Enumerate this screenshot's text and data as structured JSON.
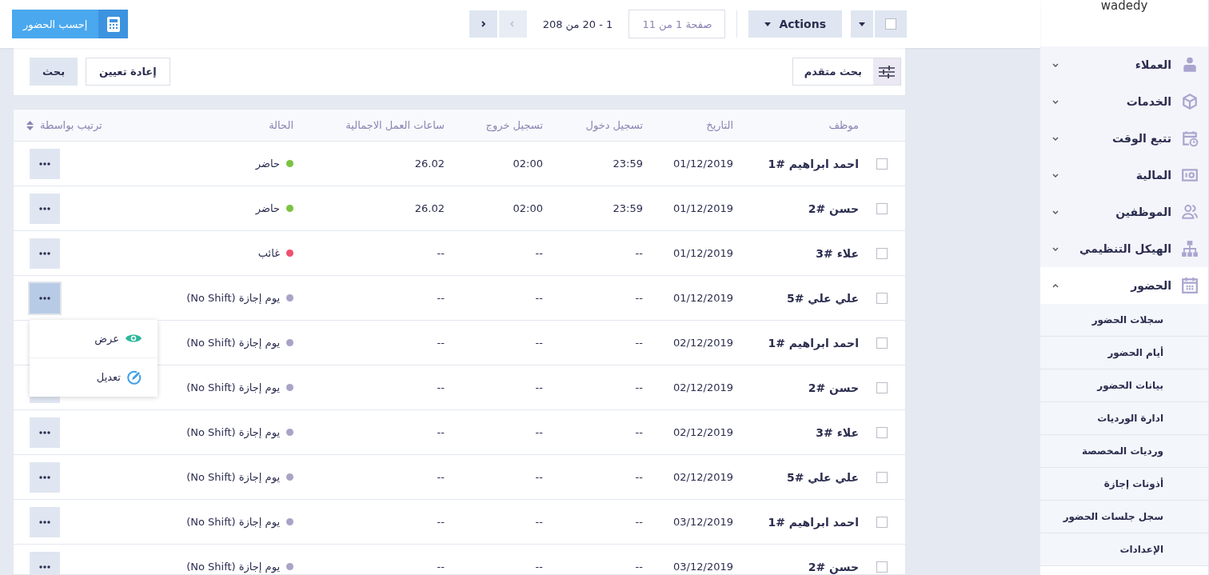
{
  "top_bar": {
    "select_all": {
      "checked": false
    },
    "actions_button": "Actions",
    "page_field": "صفحة 1 من 11",
    "range": "1 - 20 من 208",
    "pager": [
      {
        "kind": "prev",
        "disabled": true
      },
      {
        "kind": "next",
        "disabled": false
      }
    ],
    "calculate_button": "إحسب الحضور"
  },
  "filters": {
    "advanced_search": "بحث متقدم",
    "reset_button": "إعادة تعيين",
    "search_button": "بحث"
  },
  "table": {
    "columns": [
      "موظف",
      "التاريخ",
      "تسجيل دخول",
      "تسجيل خروج",
      "ساعات العمل الاجمالية",
      "الحالة",
      "ترتيب بواسطة"
    ],
    "rows": [
      {
        "checked": false,
        "employee": "احمد ابراهيم #1",
        "date": "01/12/2019",
        "check_in": "23:59",
        "check_out": "02:00",
        "total_hours": "26.02",
        "status": "حاضر",
        "color": "#7cc242",
        "menu_open": false
      },
      {
        "checked": false,
        "employee": "حسن #2",
        "date": "01/12/2019",
        "check_in": "23:59",
        "check_out": "02:00",
        "total_hours": "26.02",
        "status": "حاضر",
        "color": "#7cc242",
        "menu_open": false
      },
      {
        "checked": false,
        "employee": "علاء #3",
        "date": "01/12/2019",
        "check_in": "--",
        "check_out": "--",
        "total_hours": "--",
        "status": "غائب",
        "color": "#f0506e",
        "menu_open": false
      },
      {
        "checked": false,
        "employee": "علي علي #5",
        "date": "01/12/2019",
        "check_in": "--",
        "check_out": "--",
        "total_hours": "--",
        "status": "يوم إجازة (No Shift)",
        "color": "#a8a4c6",
        "menu_open": true
      },
      {
        "checked": false,
        "employee": "احمد ابراهيم #1",
        "date": "02/12/2019",
        "check_in": "--",
        "check_out": "--",
        "total_hours": "--",
        "status": "يوم إجازة (No Shift)",
        "color": "#a8a4c6",
        "menu_open": false
      },
      {
        "checked": false,
        "employee": "حسن #2",
        "date": "02/12/2019",
        "check_in": "--",
        "check_out": "--",
        "total_hours": "--",
        "status": "يوم إجازة (No Shift)",
        "color": "#a8a4c6",
        "menu_open": false
      },
      {
        "checked": false,
        "employee": "علاء #3",
        "date": "02/12/2019",
        "check_in": "--",
        "check_out": "--",
        "total_hours": "--",
        "status": "يوم إجازة (No Shift)",
        "color": "#a8a4c6",
        "menu_open": false
      },
      {
        "checked": false,
        "employee": "علي علي #5",
        "date": "02/12/2019",
        "check_in": "--",
        "check_out": "--",
        "total_hours": "--",
        "status": "يوم إجازة (No Shift)",
        "color": "#a8a4c6",
        "menu_open": false
      },
      {
        "checked": false,
        "employee": "احمد ابراهيم #1",
        "date": "03/12/2019",
        "check_in": "--",
        "check_out": "--",
        "total_hours": "--",
        "status": "يوم إجازة (No Shift)",
        "color": "#a8a4c6",
        "menu_open": false
      },
      {
        "checked": false,
        "employee": "حسن #2",
        "date": "03/12/2019",
        "check_in": "--",
        "check_out": "--",
        "total_hours": "--",
        "status": "يوم إجازة (No Shift)",
        "color": "#a8a4c6",
        "menu_open": false
      }
    ],
    "row_menu": [
      {
        "kind": "view",
        "label": "عرض"
      },
      {
        "kind": "edit",
        "label": "تعديل"
      }
    ]
  },
  "sidebar": {
    "account": "wadedy",
    "items": [
      {
        "kind": "person",
        "label": "العملاء",
        "expanded": false
      },
      {
        "kind": "box",
        "label": "الخدمات",
        "expanded": false
      },
      {
        "kind": "calendar-clock",
        "label": "تتبع الوقت",
        "expanded": false
      },
      {
        "kind": "safe",
        "label": "المالية",
        "expanded": false
      },
      {
        "kind": "users",
        "label": "الموظفين",
        "expanded": false
      },
      {
        "kind": "hierarchy",
        "label": "الهيكل التنظيمي",
        "expanded": false
      },
      {
        "kind": "calendar",
        "label": "الحضور",
        "expanded": true,
        "children": [
          {
            "label": "سجلات الحضور"
          },
          {
            "label": "أيام الحضور"
          },
          {
            "label": "بيانات الحضور"
          },
          {
            "label": "ادارة الورديات"
          },
          {
            "label": "ورديات المخصصة"
          },
          {
            "label": "أذونات إجازة"
          },
          {
            "label": "سجل جلسات الحضور"
          },
          {
            "label": "الإعدادات"
          }
        ]
      }
    ]
  }
}
